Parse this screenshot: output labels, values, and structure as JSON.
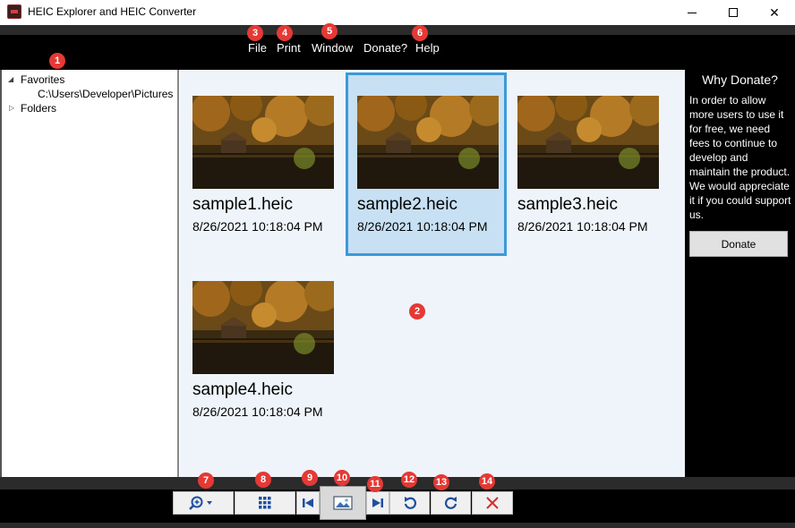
{
  "window": {
    "title": "HEIC Explorer and HEIC Converter",
    "minimize_icon": "minimize-icon",
    "maximize_icon": "maximize-icon",
    "close_glyph": "✕"
  },
  "menu": {
    "items": [
      "File",
      "Print",
      "Window",
      "Donate?",
      "Help"
    ]
  },
  "badges": [
    "1",
    "2",
    "3",
    "4",
    "5",
    "6",
    "7",
    "8",
    "9",
    "10",
    "11",
    "12",
    "13",
    "14"
  ],
  "tree": {
    "favorites_label": "Favorites",
    "favorite_path": "C:\\Users\\Developer\\Pictures",
    "folders_label": "Folders",
    "expanded_glyph": "◢",
    "collapsed_glyph": "▷"
  },
  "gallery": {
    "items": [
      {
        "name": "sample1.heic",
        "date": "8/26/2021 10:18:04 PM",
        "selected": false
      },
      {
        "name": "sample2.heic",
        "date": "8/26/2021 10:18:04 PM",
        "selected": true
      },
      {
        "name": "sample3.heic",
        "date": "8/26/2021 10:18:04 PM",
        "selected": false
      },
      {
        "name": "sample4.heic",
        "date": "8/26/2021 10:18:04 PM",
        "selected": false
      }
    ]
  },
  "donate": {
    "title": "Why Donate?",
    "text": "In order to allow more users to use it for free, we need fees to continue to develop and maintain the product. We would appreciate it if you could support us.",
    "button_label": "Donate"
  },
  "toolbar": {
    "icons": [
      "zoom-dropdown-icon",
      "grid-view-icon",
      "first-image-icon",
      "image-view-icon",
      "last-image-icon",
      "rotate-left-icon",
      "rotate-right-icon",
      "delete-icon"
    ]
  },
  "colors": {
    "accent": "#3a9ad9",
    "selection": "#c7e0f4",
    "badge": "#e53935",
    "gallery_bg": "#eef4fa",
    "tool_blue": "#1e4fa0",
    "delete_red": "#d32f2f"
  }
}
